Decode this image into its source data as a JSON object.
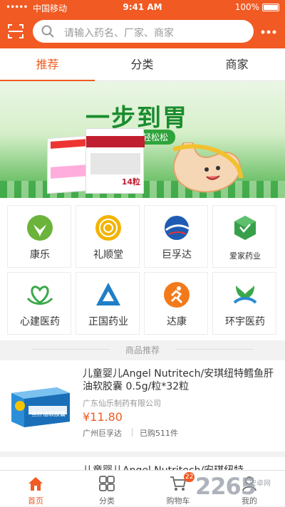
{
  "status": {
    "signal": "•••••",
    "carrier": "中国移动",
    "wifi": "wifi-icon",
    "time": "9:41 AM",
    "battery": "100%"
  },
  "search": {
    "placeholder": "请输入药名、厂家、商家",
    "scan_icon": "scan-icon",
    "more_icon": "more-icon"
  },
  "tabs": [
    {
      "label": "推荐",
      "active": true
    },
    {
      "label": "分类"
    },
    {
      "label": "商家"
    }
  ],
  "banner": {
    "title": "一步到胃",
    "subtitle": "轻轻松松",
    "box_label": "14粒"
  },
  "brands": [
    {
      "label": "康乐",
      "icon": "leaf-icon",
      "color": "#6bb33a"
    },
    {
      "label": "礼顺堂",
      "icon": "flower-icon",
      "color": "#f1b400"
    },
    {
      "label": "巨孚达",
      "icon": "globe-icon",
      "color": "#1e5cb3"
    },
    {
      "label": "爱家药业",
      "icon": "cube-icon",
      "color": "#38a04a"
    },
    {
      "label": "心建医药",
      "icon": "heart-hands-icon",
      "color": "#3aa84a"
    },
    {
      "label": "正国药业",
      "icon": "triangle-icon",
      "color": "#1f7fc7"
    },
    {
      "label": "达康",
      "icon": "runner-icon",
      "color": "#f27a1a"
    },
    {
      "label": "环宇医药",
      "icon": "sprout-icon",
      "color": "#2b8ad1"
    }
  ],
  "section": {
    "title": "商品推荐"
  },
  "products": [
    {
      "name": "儿童婴儿Angel Nutritech/安琪纽特鳕鱼肝油软胶囊 0.5g/粒*32粒",
      "company": "广东仙乐制药有限公司",
      "price": "¥11.80",
      "seller": "广州巨孚达",
      "sold": "已购511件",
      "box_text": "鱼肝油软胶囊"
    },
    {
      "name": "儿童婴儿Angel Nutritech/安琪纽特"
    }
  ],
  "bottom_nav": [
    {
      "label": "首页",
      "icon": "home-icon",
      "active": true
    },
    {
      "label": "分类",
      "icon": "grid-icon"
    },
    {
      "label": "购物车",
      "icon": "cart-icon",
      "badge": "22"
    },
    {
      "label": "我的",
      "icon": "user-icon"
    }
  ],
  "watermark": {
    "text": "2265",
    "sub": "安卓网"
  },
  "colors": {
    "primary": "#f15a22",
    "price": "#f15a22"
  }
}
